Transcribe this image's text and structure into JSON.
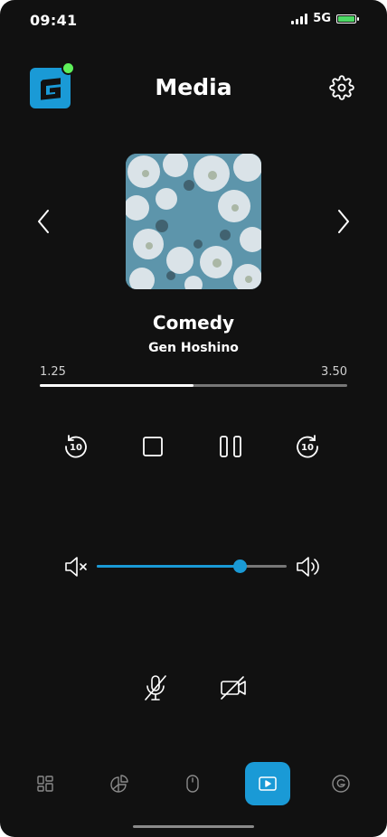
{
  "status_bar": {
    "time": "09:41",
    "network": "5G"
  },
  "header": {
    "title": "Media",
    "logo_letter": "G"
  },
  "player": {
    "track_title": "Comedy",
    "artist": "Gen Hoshino",
    "current_time": "1.25",
    "duration": "3.50",
    "progress_fraction": 0.5,
    "skip_back_seconds": "10",
    "skip_forward_seconds": "10"
  },
  "volume": {
    "level_fraction": 0.75
  },
  "bottom_nav": {
    "items": [
      "dashboard",
      "stats",
      "mouse",
      "media",
      "account"
    ],
    "active": "media"
  },
  "colors": {
    "accent": "#1a9ad6",
    "background": "#111111",
    "online": "#5ef05a",
    "battery": "#4cd964"
  }
}
